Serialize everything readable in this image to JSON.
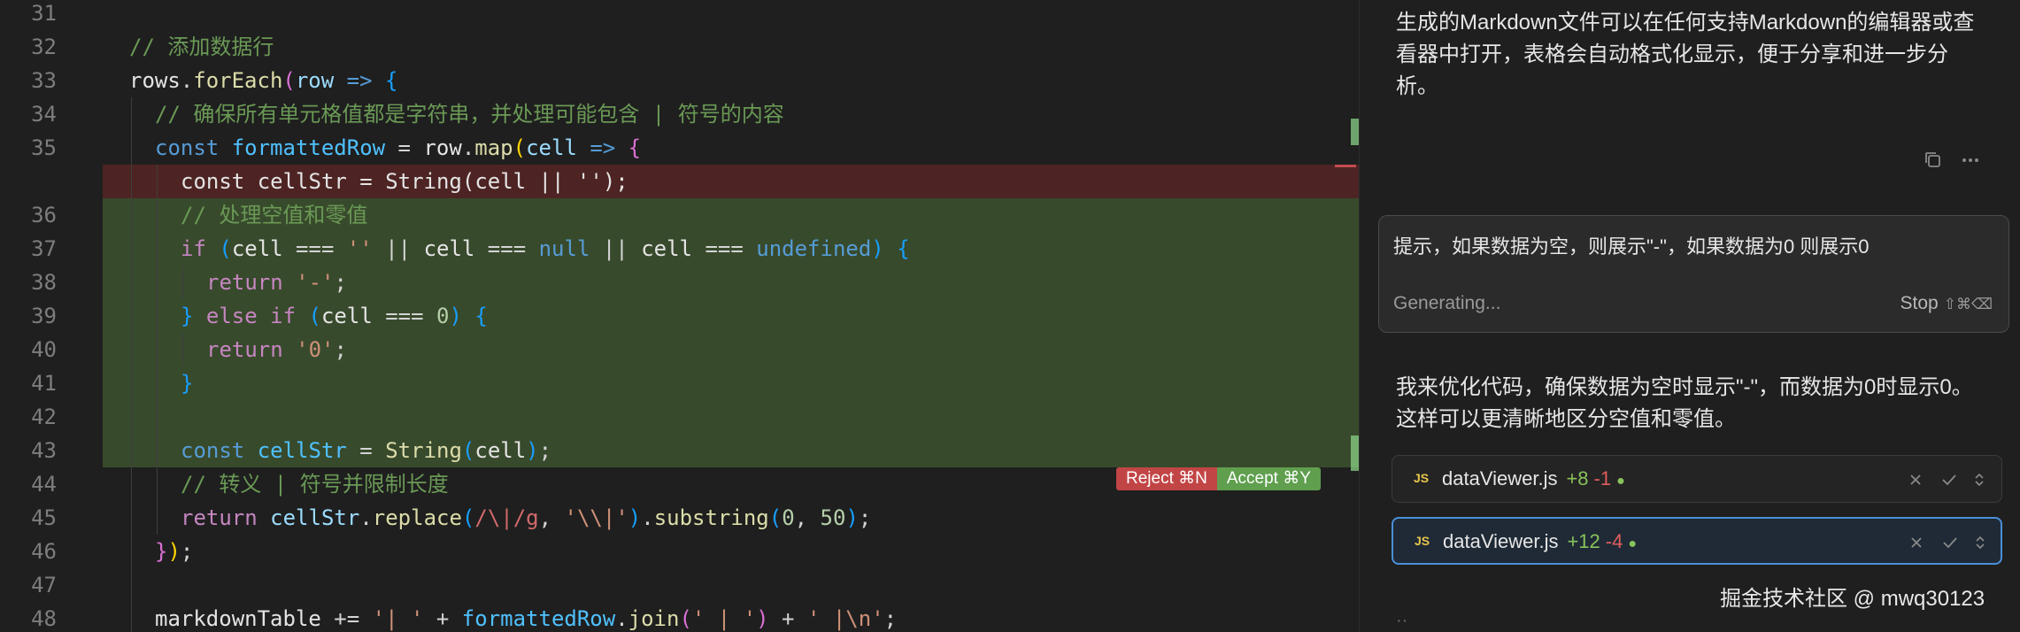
{
  "editor": {
    "lines": [
      {
        "ln": "31",
        "bg": "",
        "indent": 0,
        "tokens": []
      },
      {
        "ln": "32",
        "bg": "",
        "indent": 0,
        "tokens": [
          {
            "t": "// 添加数据行",
            "c": "comment"
          }
        ]
      },
      {
        "ln": "33",
        "bg": "",
        "indent": 0,
        "tokens": [
          {
            "t": "rows",
            "c": "white"
          },
          {
            "t": ".",
            "c": "plain"
          },
          {
            "t": "forEach",
            "c": "func"
          },
          {
            "t": "(",
            "c": "paren2"
          },
          {
            "t": "row",
            "c": "var"
          },
          {
            "t": " => ",
            "c": "keyword"
          },
          {
            "t": "{",
            "c": "paren3"
          }
        ]
      },
      {
        "ln": "34",
        "bg": "",
        "indent": 1,
        "tokens": [
          {
            "t": "// 确保所有单元格值都是字符串，并处理可能包含 | 符号的内容",
            "c": "comment"
          }
        ]
      },
      {
        "ln": "35",
        "bg": "",
        "indent": 1,
        "tokens": [
          {
            "t": "const",
            "c": "keyword"
          },
          {
            "t": " ",
            "c": "plain"
          },
          {
            "t": "formattedRow",
            "c": "const"
          },
          {
            "t": " = ",
            "c": "plain"
          },
          {
            "t": "row",
            "c": "white"
          },
          {
            "t": ".",
            "c": "plain"
          },
          {
            "t": "map",
            "c": "func"
          },
          {
            "t": "(",
            "c": "paren1"
          },
          {
            "t": "cell",
            "c": "var"
          },
          {
            "t": " => ",
            "c": "keyword"
          },
          {
            "t": "{",
            "c": "paren2"
          }
        ]
      },
      {
        "ln": "",
        "bg": "del",
        "indent": 2,
        "tokens": [
          {
            "t": "const cellStr = String(cell || '');",
            "c": "white"
          }
        ]
      },
      {
        "ln": "36",
        "bg": "add",
        "indent": 2,
        "tokens": [
          {
            "t": "// 处理空值和零值",
            "c": "comment"
          }
        ]
      },
      {
        "ln": "37",
        "bg": "add",
        "indent": 2,
        "tokens": [
          {
            "t": "if",
            "c": "control"
          },
          {
            "t": " ",
            "c": "plain"
          },
          {
            "t": "(",
            "c": "paren3"
          },
          {
            "t": "cell",
            "c": "white"
          },
          {
            "t": " === ",
            "c": "plain"
          },
          {
            "t": "''",
            "c": "string"
          },
          {
            "t": " || ",
            "c": "plain"
          },
          {
            "t": "cell",
            "c": "white"
          },
          {
            "t": " === ",
            "c": "plain"
          },
          {
            "t": "null",
            "c": "keyword"
          },
          {
            "t": " || ",
            "c": "plain"
          },
          {
            "t": "cell",
            "c": "white"
          },
          {
            "t": " === ",
            "c": "plain"
          },
          {
            "t": "undefined",
            "c": "keyword"
          },
          {
            "t": ")",
            "c": "paren3"
          },
          {
            "t": " ",
            "c": "plain"
          },
          {
            "t": "{",
            "c": "paren3"
          }
        ]
      },
      {
        "ln": "38",
        "bg": "add",
        "indent": 3,
        "tokens": [
          {
            "t": "return",
            "c": "control"
          },
          {
            "t": " ",
            "c": "plain"
          },
          {
            "t": "'-'",
            "c": "string"
          },
          {
            "t": ";",
            "c": "plain"
          }
        ]
      },
      {
        "ln": "39",
        "bg": "add",
        "indent": 2,
        "tokens": [
          {
            "t": "}",
            "c": "paren3"
          },
          {
            "t": " ",
            "c": "plain"
          },
          {
            "t": "else if",
            "c": "control"
          },
          {
            "t": " ",
            "c": "plain"
          },
          {
            "t": "(",
            "c": "paren3"
          },
          {
            "t": "cell",
            "c": "white"
          },
          {
            "t": " === ",
            "c": "plain"
          },
          {
            "t": "0",
            "c": "number"
          },
          {
            "t": ")",
            "c": "paren3"
          },
          {
            "t": " ",
            "c": "plain"
          },
          {
            "t": "{",
            "c": "paren3"
          }
        ]
      },
      {
        "ln": "40",
        "bg": "add",
        "indent": 3,
        "tokens": [
          {
            "t": "return",
            "c": "control"
          },
          {
            "t": " ",
            "c": "plain"
          },
          {
            "t": "'0'",
            "c": "string"
          },
          {
            "t": ";",
            "c": "plain"
          }
        ]
      },
      {
        "ln": "41",
        "bg": "add",
        "indent": 2,
        "tokens": [
          {
            "t": "}",
            "c": "paren3"
          }
        ]
      },
      {
        "ln": "42",
        "bg": "add",
        "indent": 2,
        "tokens": []
      },
      {
        "ln": "43",
        "bg": "add",
        "indent": 2,
        "tokens": [
          {
            "t": "const",
            "c": "keyword"
          },
          {
            "t": " ",
            "c": "plain"
          },
          {
            "t": "cellStr",
            "c": "const"
          },
          {
            "t": " = ",
            "c": "plain"
          },
          {
            "t": "String",
            "c": "ident"
          },
          {
            "t": "(",
            "c": "paren3"
          },
          {
            "t": "cell",
            "c": "white"
          },
          {
            "t": ")",
            "c": "paren3"
          },
          {
            "t": ";",
            "c": "plain"
          }
        ]
      },
      {
        "ln": "44",
        "bg": "",
        "indent": 2,
        "tokens": [
          {
            "t": "// 转义 | 符号并限制长度",
            "c": "comment"
          }
        ]
      },
      {
        "ln": "45",
        "bg": "",
        "indent": 2,
        "tokens": [
          {
            "t": "return",
            "c": "control"
          },
          {
            "t": " ",
            "c": "plain"
          },
          {
            "t": "cellStr",
            "c": "var"
          },
          {
            "t": ".",
            "c": "plain"
          },
          {
            "t": "replace",
            "c": "func"
          },
          {
            "t": "(",
            "c": "paren3"
          },
          {
            "t": "/\\|/g",
            "c": "regex"
          },
          {
            "t": ", ",
            "c": "plain"
          },
          {
            "t": "'\\\\|'",
            "c": "string"
          },
          {
            "t": ")",
            "c": "paren3"
          },
          {
            "t": ".",
            "c": "plain"
          },
          {
            "t": "substring",
            "c": "func"
          },
          {
            "t": "(",
            "c": "paren3"
          },
          {
            "t": "0",
            "c": "number"
          },
          {
            "t": ", ",
            "c": "plain"
          },
          {
            "t": "50",
            "c": "number"
          },
          {
            "t": ")",
            "c": "paren3"
          },
          {
            "t": ";",
            "c": "plain"
          }
        ]
      },
      {
        "ln": "46",
        "bg": "",
        "indent": 1,
        "tokens": [
          {
            "t": "}",
            "c": "paren2"
          },
          {
            "t": ")",
            "c": "paren1"
          },
          {
            "t": ";",
            "c": "plain"
          }
        ]
      },
      {
        "ln": "47",
        "bg": "",
        "indent": 1,
        "tokens": []
      },
      {
        "ln": "48",
        "bg": "",
        "indent": 1,
        "tokens": [
          {
            "t": "markdownTable",
            "c": "white"
          },
          {
            "t": " += ",
            "c": "plain"
          },
          {
            "t": "'| '",
            "c": "string"
          },
          {
            "t": " + ",
            "c": "plain"
          },
          {
            "t": "formattedRow",
            "c": "const"
          },
          {
            "t": ".",
            "c": "plain"
          },
          {
            "t": "join",
            "c": "func"
          },
          {
            "t": "(",
            "c": "paren2"
          },
          {
            "t": "' | '",
            "c": "string"
          },
          {
            "t": ")",
            "c": "paren2"
          },
          {
            "t": " + ",
            "c": "plain"
          },
          {
            "t": "' |\\n'",
            "c": "string"
          },
          {
            "t": ";",
            "c": "plain"
          }
        ]
      }
    ],
    "diff_actions": {
      "reject_label": "Reject ⌘N",
      "accept_label": "Accept ⌘Y"
    },
    "colors": {
      "added_bg": "#384a2c",
      "removed_bg": "#4d2423",
      "reject": "#c24546",
      "accept": "#5f9f4e"
    }
  },
  "chat": {
    "response_intro": "生成的Markdown文件可以在任何支持Markdown的编辑器或查看器中打开，表格会自动格式化显示，便于分享和进一步分析。",
    "message_actions": [
      "copy-icon",
      "more-icon"
    ],
    "input": {
      "text": "提示，如果数据为空，则展示\"-\"，如果数据为0 则展示0",
      "status": "Generating...",
      "stop_label": "Stop",
      "stop_shortcut": "⇧⌘⌫"
    },
    "response_text": "我来优化代码，确保数据为空时显示\"-\"，而数据为0时显示0。这样可以更清晰地区分空值和零值。",
    "files": [
      {
        "badge": "JS",
        "name": "dataViewer.js",
        "additions": "+8",
        "deletions": "-1",
        "active": false
      },
      {
        "badge": "JS",
        "name": "dataViewer.js",
        "additions": "+12",
        "deletions": "-4",
        "active": true
      }
    ],
    "accent_color": "#4a8fd6"
  },
  "watermark": "掘金技术社区 @ mwq30123"
}
